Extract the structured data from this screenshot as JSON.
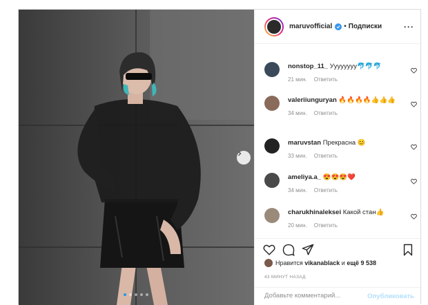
{
  "post": {
    "username": "maruvofficial",
    "follow_label": "Подписки",
    "icons": {
      "verified": "verified-badge-icon",
      "more": "more-options-icon",
      "next": "chevron-right-icon"
    }
  },
  "comments": [
    {
      "user": "nonstop_11_",
      "text": "Уууууууу🐬🐬🐬",
      "time": "21 мин.",
      "reply": "Ответить",
      "avatar_color": "#3a4a5a"
    },
    {
      "user": "valeriiunguryan",
      "text": "🔥🔥🔥🔥👍👍👍",
      "time": "34 мин.",
      "reply": "Ответить",
      "avatar_color": "#8a6a5a"
    },
    {
      "user": "maruvstan",
      "text": "Прекрасна 😊",
      "time": "33 мин.",
      "reply": "Ответить",
      "avatar_color": "#222222"
    },
    {
      "user": "ameliya.a_",
      "text": "😍😍😍❤️",
      "time": "34 мин.",
      "reply": "Ответить",
      "avatar_color": "#4a4a4a"
    },
    {
      "user": "charukhinaleksei",
      "text": "Какой стан👍",
      "time": "20 мин.",
      "reply": "Ответить",
      "avatar_color": "#9a8a7a"
    }
  ],
  "likes": {
    "prefix": "Нравится",
    "user": "vikanablack",
    "middle": "и",
    "count": "ещё 9 538"
  },
  "timestamp": "43 МИНУТ НАЗАД",
  "add_comment": {
    "placeholder": "Добавьте комментарий...",
    "publish_label": "Опубликовать"
  },
  "carousel": {
    "slides": 5,
    "active": 0
  },
  "colors": {
    "accent": "#3897f0",
    "publish_disabled": "#b2dffc",
    "active_dot": "#1a9bf0"
  }
}
